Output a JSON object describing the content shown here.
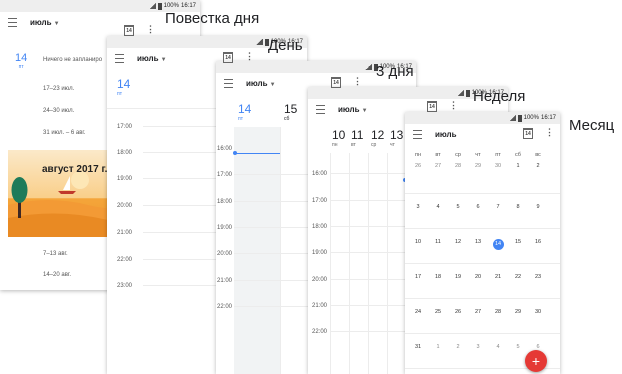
{
  "status": {
    "battery": "100%",
    "time": "16:17"
  },
  "captions": {
    "schedule": "Повестка дня",
    "day": "День",
    "three_day": "3 дня",
    "week": "Неделя",
    "month": "Месяц"
  },
  "toolbar_month": "июль",
  "calendar_icon_day": "14",
  "agenda": {
    "date_num": "14",
    "date_wd": "пт",
    "nothing": "Ничего не запланиро",
    "weeks": [
      "17–23 июл.",
      "24–30 июл.",
      "31 июл. – 6 авг."
    ],
    "banner": "август 2017 г.",
    "aug_weeks": [
      "7–13 авг.",
      "14–20 авг."
    ]
  },
  "day_view": {
    "date_num": "14",
    "date_wd": "пт",
    "hours": [
      "17:00",
      "18:00",
      "19:00",
      "20:00",
      "21:00",
      "22:00",
      "23:00"
    ]
  },
  "three_day": {
    "days": [
      {
        "num": "14",
        "wd": "пт"
      },
      {
        "num": "15",
        "wd": "сб"
      }
    ],
    "hours": [
      "16:00",
      "17:00",
      "18:00",
      "19:00",
      "20:00",
      "21:00",
      "22:00"
    ]
  },
  "week": {
    "days": [
      {
        "num": "10",
        "wd": "пн"
      },
      {
        "num": "11",
        "wd": "вт"
      },
      {
        "num": "12",
        "wd": "ср"
      },
      {
        "num": "13",
        "wd": "чт"
      }
    ],
    "hours": [
      "16:00",
      "17:00",
      "18:00",
      "19:00",
      "20:00",
      "21:00",
      "22:00"
    ]
  },
  "month_view": {
    "weekdays": [
      "пн",
      "вт",
      "ср",
      "чт",
      "пт",
      "сб",
      "вс"
    ],
    "rows": [
      [
        "26",
        "27",
        "28",
        "29",
        "30",
        "1",
        "2"
      ],
      [
        "3",
        "4",
        "5",
        "6",
        "7",
        "8",
        "9"
      ],
      [
        "10",
        "11",
        "12",
        "13",
        "14",
        "15",
        "16"
      ],
      [
        "17",
        "18",
        "19",
        "20",
        "21",
        "22",
        "23"
      ],
      [
        "24",
        "25",
        "26",
        "27",
        "28",
        "29",
        "30"
      ],
      [
        "31",
        "1",
        "2",
        "3",
        "4",
        "5",
        "6"
      ]
    ],
    "today": "14",
    "fab": "+"
  },
  "colors": {
    "accent": "#4285f4",
    "fab": "#e53935",
    "banner": "#f4a53a"
  }
}
